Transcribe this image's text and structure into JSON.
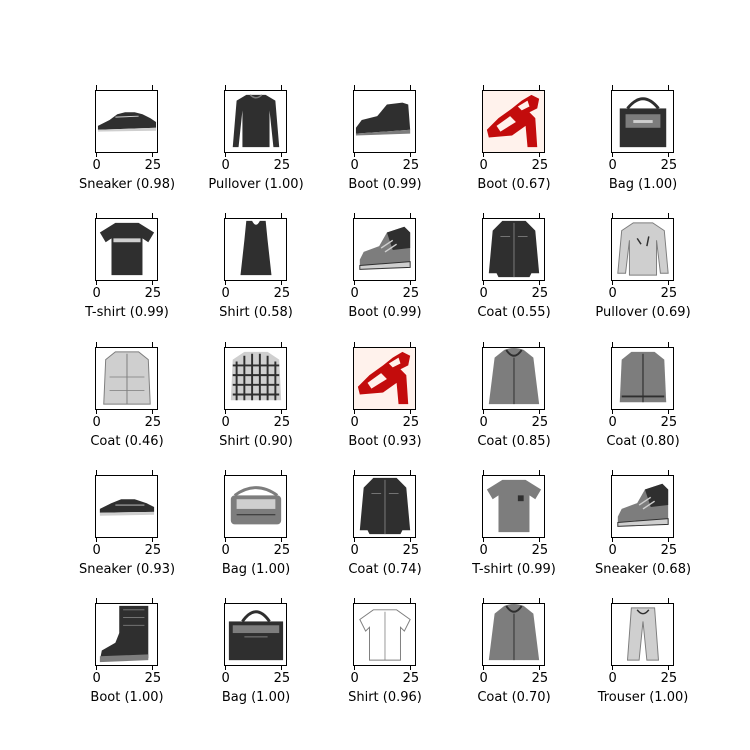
{
  "chart_data": {
    "type": "image-grid",
    "rows": 5,
    "cols": 5,
    "x_ticks": [
      "0",
      "25"
    ],
    "panels": [
      {
        "label": "Sneaker (0.98)",
        "item": "sneaker",
        "colormap": "gray"
      },
      {
        "label": "Pullover (1.00)",
        "item": "pullover",
        "colormap": "gray"
      },
      {
        "label": "Boot (0.99)",
        "item": "ankle-boot",
        "colormap": "gray"
      },
      {
        "label": "Boot (0.67)",
        "item": "sandal",
        "colormap": "red"
      },
      {
        "label": "Bag (1.00)",
        "item": "bag",
        "colormap": "gray"
      },
      {
        "label": "T-shirt (0.99)",
        "item": "tshirt",
        "colormap": "gray"
      },
      {
        "label": "Shirt (0.58)",
        "item": "tank-top",
        "colormap": "gray"
      },
      {
        "label": "Boot (0.99)",
        "item": "high-sneaker",
        "colormap": "gray"
      },
      {
        "label": "Coat (0.55)",
        "item": "coat-dark",
        "colormap": "gray"
      },
      {
        "label": "Pullover (0.69)",
        "item": "pullover-light",
        "colormap": "gray"
      },
      {
        "label": "Coat (0.46)",
        "item": "coat-light",
        "colormap": "gray"
      },
      {
        "label": "Shirt (0.90)",
        "item": "plaid-shirt",
        "colormap": "gray"
      },
      {
        "label": "Boot (0.93)",
        "item": "sandal",
        "colormap": "red"
      },
      {
        "label": "Coat (0.85)",
        "item": "hoodie",
        "colormap": "gray"
      },
      {
        "label": "Coat (0.80)",
        "item": "jacket",
        "colormap": "gray"
      },
      {
        "label": "Sneaker (0.93)",
        "item": "sneaker-low",
        "colormap": "gray"
      },
      {
        "label": "Bag (1.00)",
        "item": "shoulder-bag",
        "colormap": "gray"
      },
      {
        "label": "Coat (0.74)",
        "item": "coat-dark",
        "colormap": "gray"
      },
      {
        "label": "T-shirt (0.99)",
        "item": "tshirt-gray",
        "colormap": "gray"
      },
      {
        "label": "Sneaker (0.68)",
        "item": "high-sneaker",
        "colormap": "gray"
      },
      {
        "label": "Boot (1.00)",
        "item": "tall-boot",
        "colormap": "gray"
      },
      {
        "label": "Bag (1.00)",
        "item": "tote-bag",
        "colormap": "gray"
      },
      {
        "label": "Shirt (0.96)",
        "item": "white-shirt",
        "colormap": "gray"
      },
      {
        "label": "Coat (0.70)",
        "item": "hoodie",
        "colormap": "gray"
      },
      {
        "label": "Trouser (1.00)",
        "item": "trousers",
        "colormap": "gray"
      }
    ]
  }
}
